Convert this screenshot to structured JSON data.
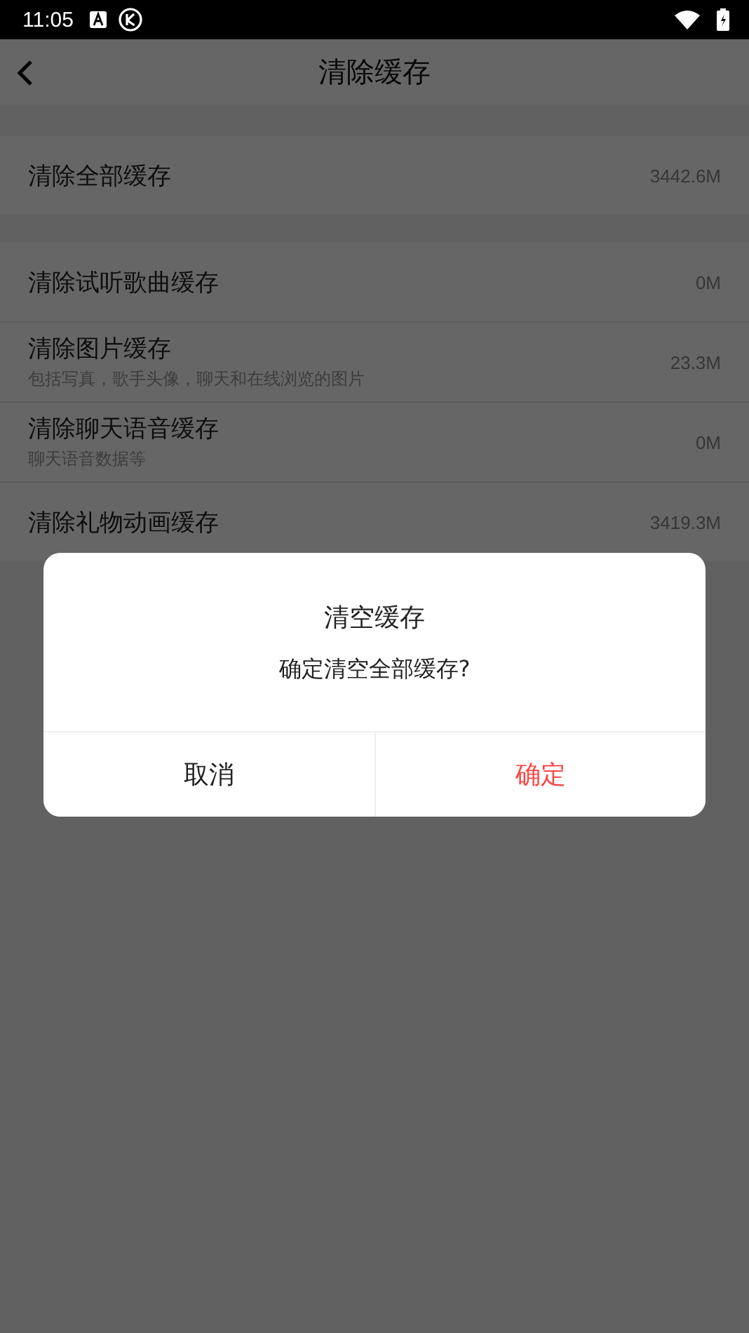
{
  "status_bar": {
    "time": "11:05"
  },
  "header": {
    "title": "清除缓存"
  },
  "groups": [
    {
      "items": [
        {
          "label": "清除全部缓存",
          "size": "3442.6M"
        }
      ]
    },
    {
      "items": [
        {
          "label": "清除试听歌曲缓存",
          "size": "0M"
        },
        {
          "label": "清除图片缓存",
          "subtitle": "包括写真，歌手头像，聊天和在线浏览的图片",
          "size": "23.3M"
        },
        {
          "label": "清除聊天语音缓存",
          "subtitle": "聊天语音数据等",
          "size": "0M"
        },
        {
          "label": "清除礼物动画缓存",
          "size": "3419.3M"
        }
      ]
    }
  ],
  "dialog": {
    "title": "清空缓存",
    "message": "确定清空全部缓存?",
    "buttons": [
      {
        "label": "取消",
        "kind": "cancel"
      },
      {
        "label": "确定",
        "kind": "confirm"
      }
    ]
  }
}
